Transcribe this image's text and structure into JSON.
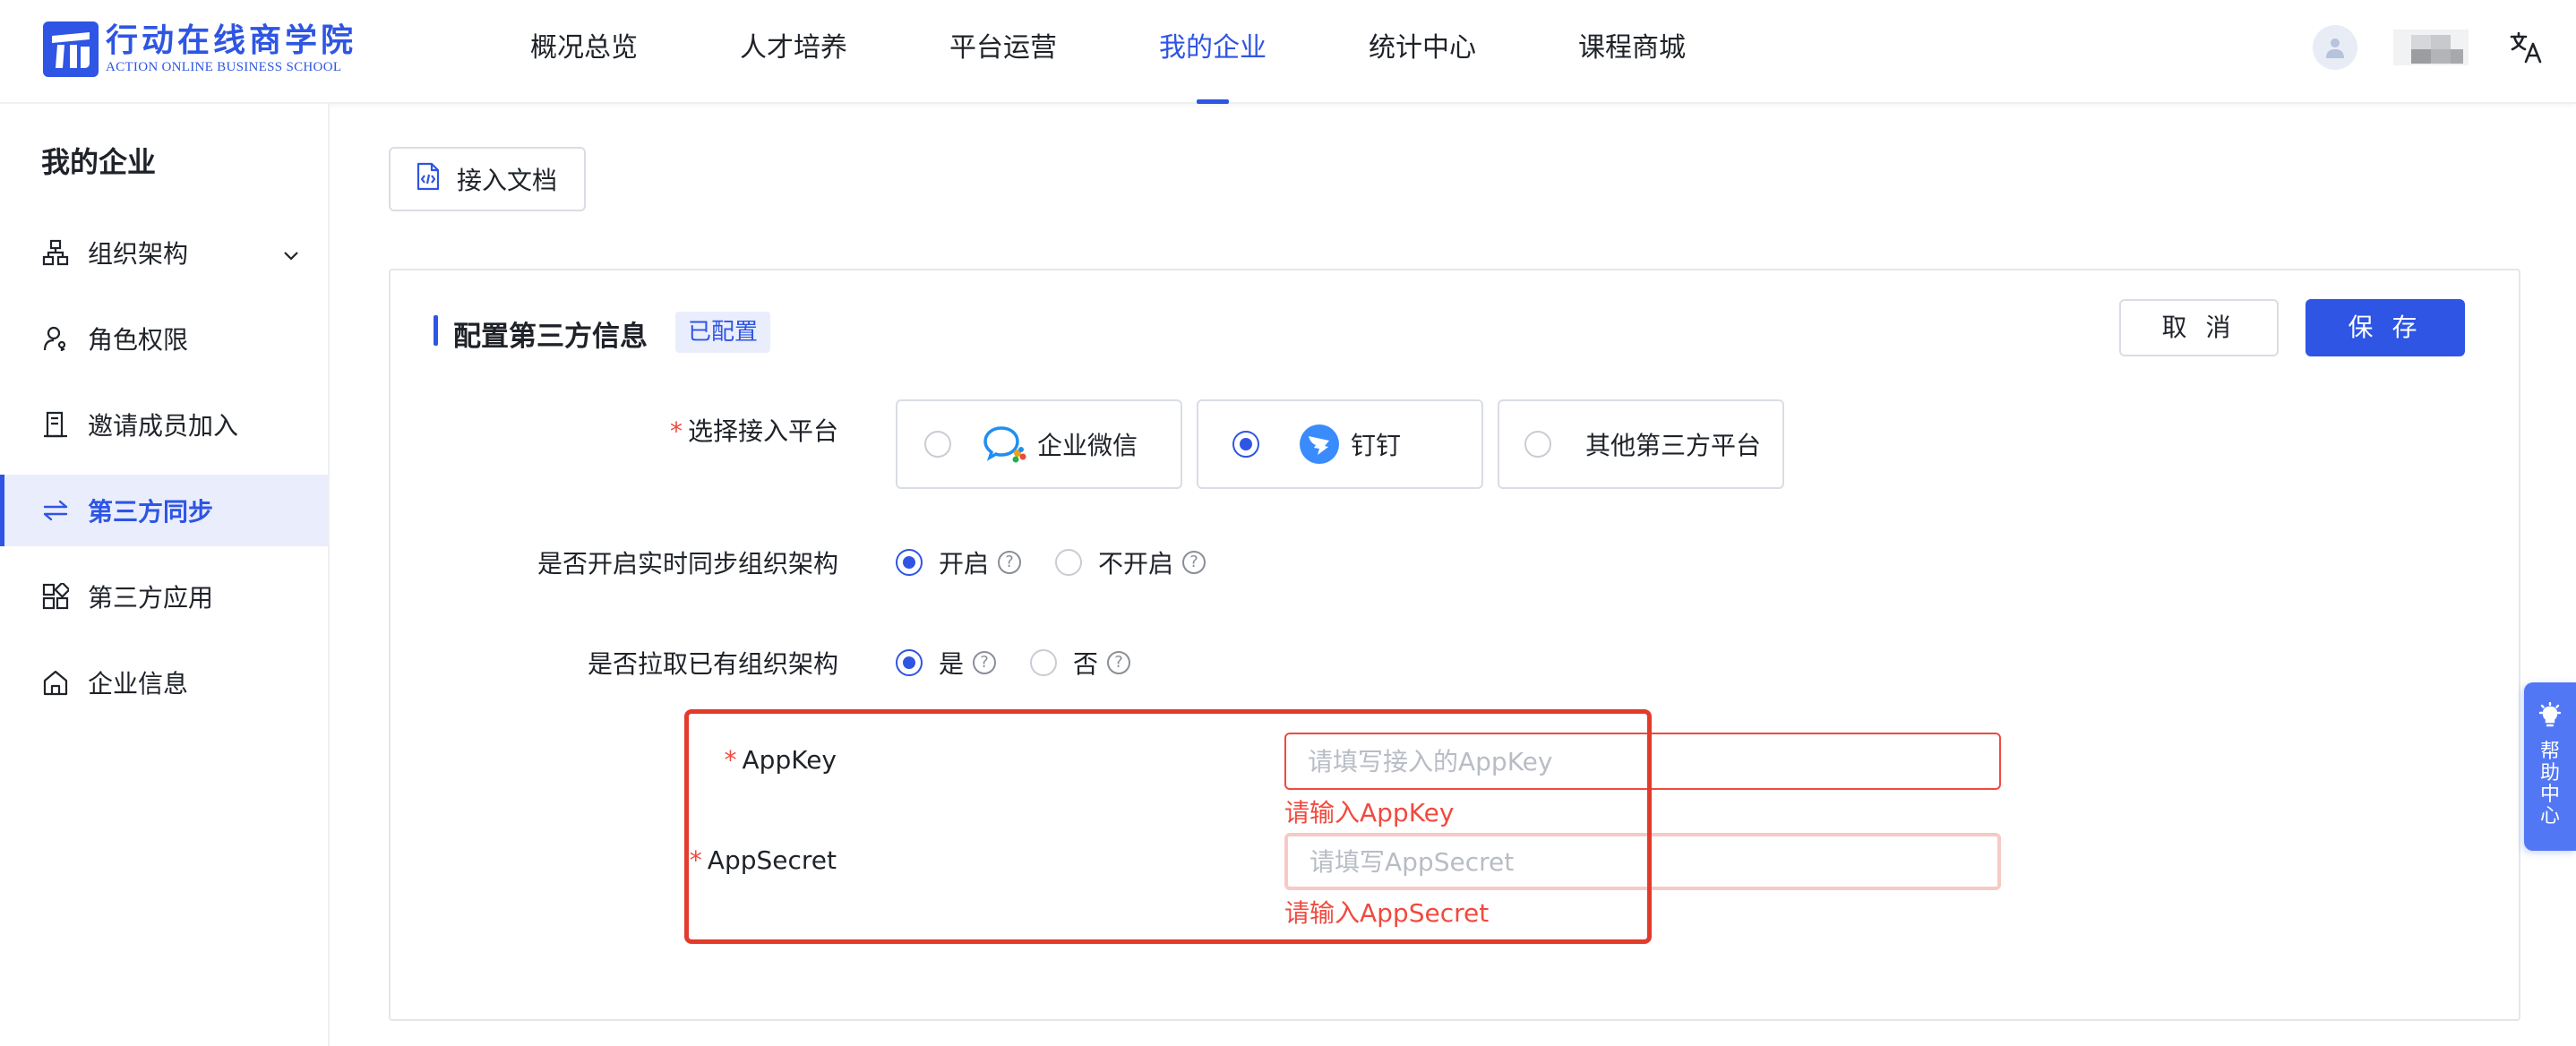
{
  "brand": {
    "name_cn": "行动在线商学院",
    "name_en": "ACTION ONLINE BUSINESS SCHOOL",
    "color": "#2e55e3"
  },
  "nav": {
    "items": [
      {
        "label": "概况总览"
      },
      {
        "label": "人才培养"
      },
      {
        "label": "平台运营"
      },
      {
        "label": "我的企业",
        "active": true
      },
      {
        "label": "统计中心"
      },
      {
        "label": "课程商城"
      }
    ]
  },
  "header_right": {
    "avatar_icon": "user-avatar-icon",
    "language_icon": "translate-icon"
  },
  "sidebar": {
    "title": "我的企业",
    "items": [
      {
        "label": "组织架构",
        "icon": "org-chart-icon",
        "expandable": true
      },
      {
        "label": "角色权限",
        "icon": "user-key-icon"
      },
      {
        "label": "邀请成员加入",
        "icon": "invite-doc-icon"
      },
      {
        "label": "第三方同步",
        "icon": "sync-arrows-icon",
        "active": true
      },
      {
        "label": "第三方应用",
        "icon": "apps-grid-icon"
      },
      {
        "label": "企业信息",
        "icon": "home-icon"
      }
    ]
  },
  "toolbar": {
    "doc_button": "接入文档"
  },
  "config": {
    "title": "配置第三方信息",
    "status_badge": "已配置",
    "cancel_label": "取 消",
    "save_label": "保 存",
    "platform": {
      "label": "选择接入平台",
      "options": [
        {
          "label": "企业微信",
          "selected": false
        },
        {
          "label": "钉钉",
          "selected": true
        },
        {
          "label": "其他第三方平台",
          "selected": false
        }
      ]
    },
    "realtime_sync": {
      "label": "是否开启实时同步组织架构",
      "options": [
        {
          "label": "开启",
          "selected": true
        },
        {
          "label": "不开启",
          "selected": false
        }
      ]
    },
    "pull_existing": {
      "label": "是否拉取已有组织架构",
      "options": [
        {
          "label": "是",
          "selected": true
        },
        {
          "label": "否",
          "selected": false
        }
      ]
    },
    "app_key": {
      "label": "AppKey",
      "placeholder": "请填写接入的AppKey",
      "value": "",
      "error": "请输入AppKey"
    },
    "app_secret": {
      "label": "AppSecret",
      "placeholder": "请填写AppSecret",
      "value": "",
      "error": "请输入AppSecret"
    }
  },
  "help": {
    "label": "帮助中心"
  },
  "colors": {
    "accent": "#2e55e3",
    "error": "#f04a3f",
    "highlight": "#e23b2b"
  }
}
